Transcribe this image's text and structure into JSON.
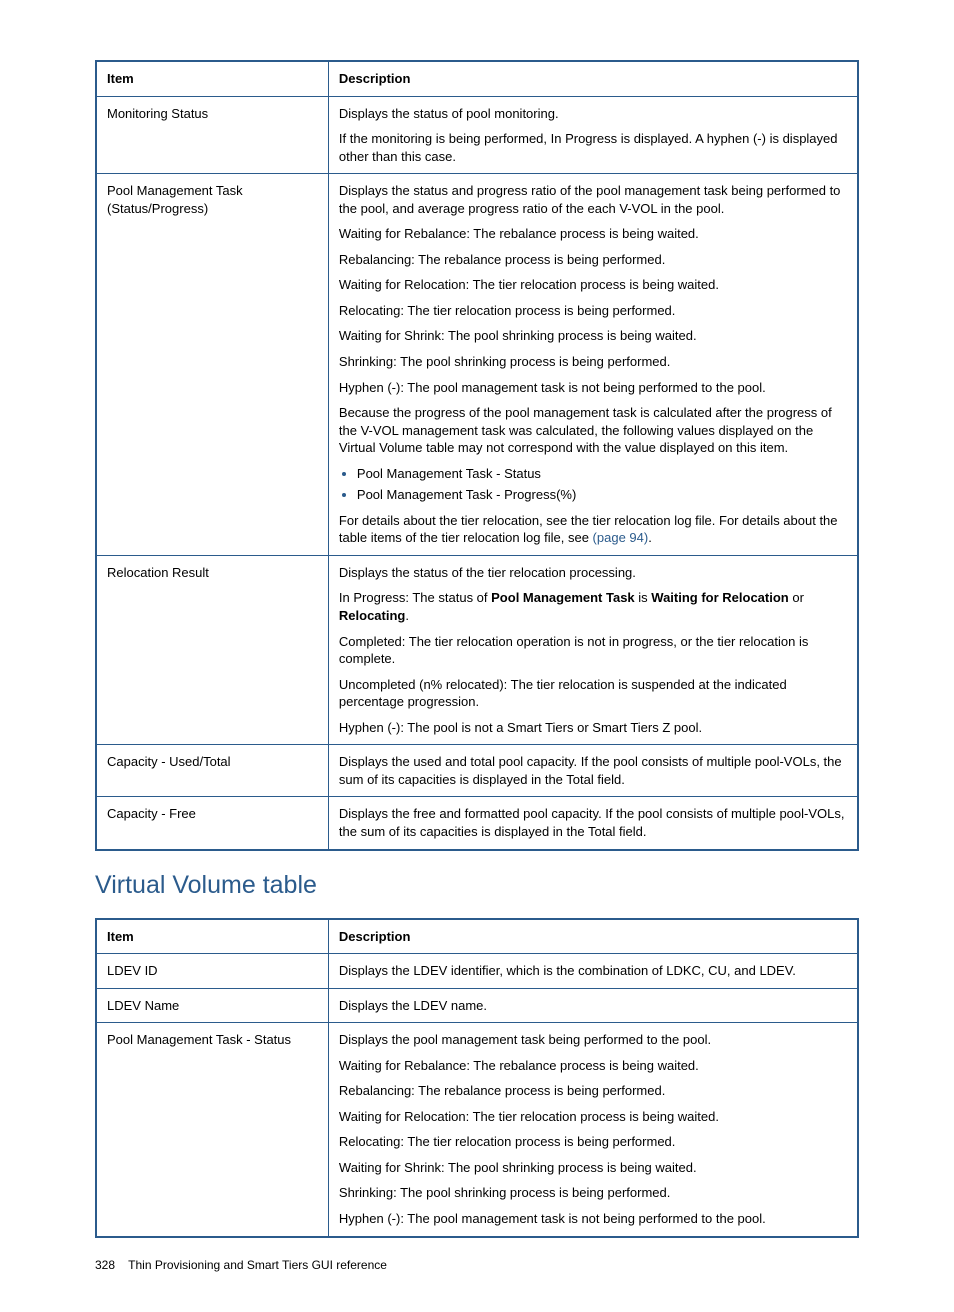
{
  "table1": {
    "headers": {
      "item": "Item",
      "description": "Description"
    },
    "rows": [
      {
        "item": "Monitoring Status",
        "p1": "Displays the status of pool monitoring.",
        "p2": "If the monitoring is being performed, In Progress is displayed. A hyphen (-) is displayed other than this case."
      },
      {
        "item": "Pool Management Task (Status/Progress)",
        "p1": "Displays the status and progress ratio of the pool management task being performed to the pool, and average progress ratio of the each V-VOL in the pool.",
        "p2": "Waiting for Rebalance: The rebalance process is being waited.",
        "p3": "Rebalancing: The rebalance process is being performed.",
        "p4": "Waiting for Relocation: The tier relocation process is being waited.",
        "p5": "Relocating: The tier relocation process is being performed.",
        "p6": "Waiting for Shrink: The pool shrinking process is being waited.",
        "p7": "Shrinking: The pool shrinking process is being performed.",
        "p8": "Hyphen (-): The pool management task is not being performed to the pool.",
        "p9": "Because the progress of the pool management task is calculated after the progress of the V-VOL management task was calculated, the following values displayed on the Virtual Volume table may not correspond with the value displayed on this item.",
        "li1": "Pool Management Task - Status",
        "li2": "Pool Management Task - Progress(%)",
        "p10a": "For details about the tier relocation, see the tier relocation log file. For details about the table items of the tier relocation log file, see ",
        "p10link": "(page 94)",
        "p10b": "."
      },
      {
        "item": "Relocation Result",
        "p1": "Displays the status of the tier relocation processing.",
        "p2a": "In Progress: The status of ",
        "p2b": "Pool Management Task",
        "p2c": " is ",
        "p2d": "Waiting for Relocation",
        "p2e": " or ",
        "p2f": "Relocating",
        "p2g": ".",
        "p3": "Completed: The tier relocation operation is not in progress, or the tier relocation is complete.",
        "p4": "Uncompleted (n% relocated): The tier relocation is suspended at the indicated percentage progression.",
        "p5": "Hyphen (-): The pool is not a Smart Tiers or Smart Tiers Z pool."
      },
      {
        "item": "Capacity - Used/Total",
        "p1": "Displays the used and total pool capacity. If the pool consists of multiple pool-VOLs, the sum of its capacities is displayed in the Total field."
      },
      {
        "item": "Capacity - Free",
        "p1": "Displays the free and formatted pool capacity. If the pool consists of multiple pool-VOLs, the sum of its capacities is displayed in the Total field."
      }
    ]
  },
  "section_title": "Virtual Volume table",
  "table2": {
    "headers": {
      "item": "Item",
      "description": "Description"
    },
    "rows": [
      {
        "item": "LDEV ID",
        "p1": "Displays the LDEV identifier, which is the combination of LDKC, CU, and LDEV."
      },
      {
        "item": "LDEV Name",
        "p1": "Displays the LDEV name."
      },
      {
        "item": "Pool Management Task - Status",
        "p1": "Displays the pool management task being performed to the pool.",
        "p2": "Waiting for Rebalance: The rebalance process is being waited.",
        "p3": "Rebalancing: The rebalance process is being performed.",
        "p4": "Waiting for Relocation: The tier relocation process is being waited.",
        "p5": "Relocating: The tier relocation process is being performed.",
        "p6": "Waiting for Shrink: The pool shrinking process is being waited.",
        "p7": "Shrinking: The pool shrinking process is being performed.",
        "p8": "Hyphen (-): The pool management task is not being performed to the pool."
      }
    ]
  },
  "footer": {
    "page": "328",
    "text": "Thin Provisioning and Smart Tiers GUI reference"
  }
}
